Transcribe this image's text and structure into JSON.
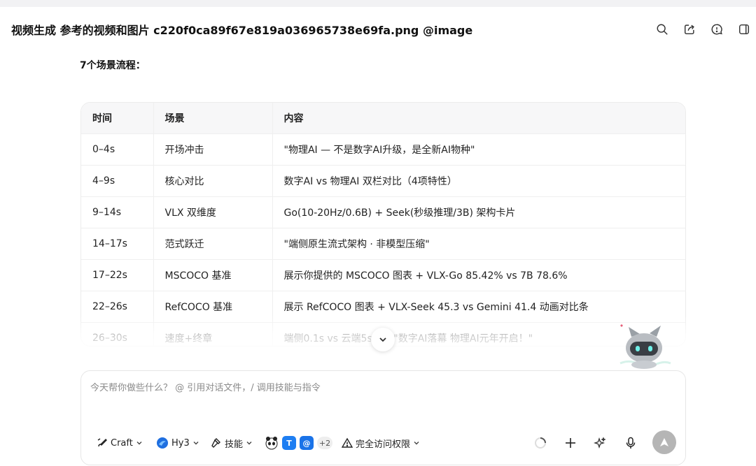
{
  "header": {
    "title": "视频生成 参考的视频和图片 c220f0ca89f67e819a036965738e69fa.png @image#2..."
  },
  "content": {
    "section_label": "7个场景流程：",
    "table": {
      "headers": [
        "时间",
        "场景",
        "内容"
      ],
      "rows": [
        [
          "0–4s",
          "开场冲击",
          "\"物理AI — 不是数字AI升级，是全新AI物种\""
        ],
        [
          "4–9s",
          "核心对比",
          "数字AI vs 物理AI 双栏对比（4项特性）"
        ],
        [
          "9–14s",
          "VLX 双维度",
          "Go(10-20Hz/0.6B) + Seek(秒级推理/3B) 架构卡片"
        ],
        [
          "14–17s",
          "范式跃迁",
          "\"端侧原生流式架构 · 非模型压缩\""
        ],
        [
          "17–22s",
          "MSCOCO 基准",
          "展示你提供的 MSCOCO 图表 + VLX-Go 85.42% vs 7B 78.6%"
        ],
        [
          "22–26s",
          "RefCOCO 基准",
          "展示 RefCOCO 图表 + VLX-Seek 45.3 vs Gemini 41.4 动画对比条"
        ],
        [
          "26–30s",
          "速度+终章",
          "端侧0.1s vs 云端5s ) → \"数字AI落幕 物理AI元年开启！\""
        ]
      ]
    }
  },
  "composer": {
    "placeholder": "今天帮你做些什么？ @ 引用对话文件，/ 调用技能与指令",
    "craft_label": "Craft",
    "model_label": "Hy3",
    "skills_label": "技能",
    "more_count": "+2",
    "access_label": "完全访问权限"
  }
}
